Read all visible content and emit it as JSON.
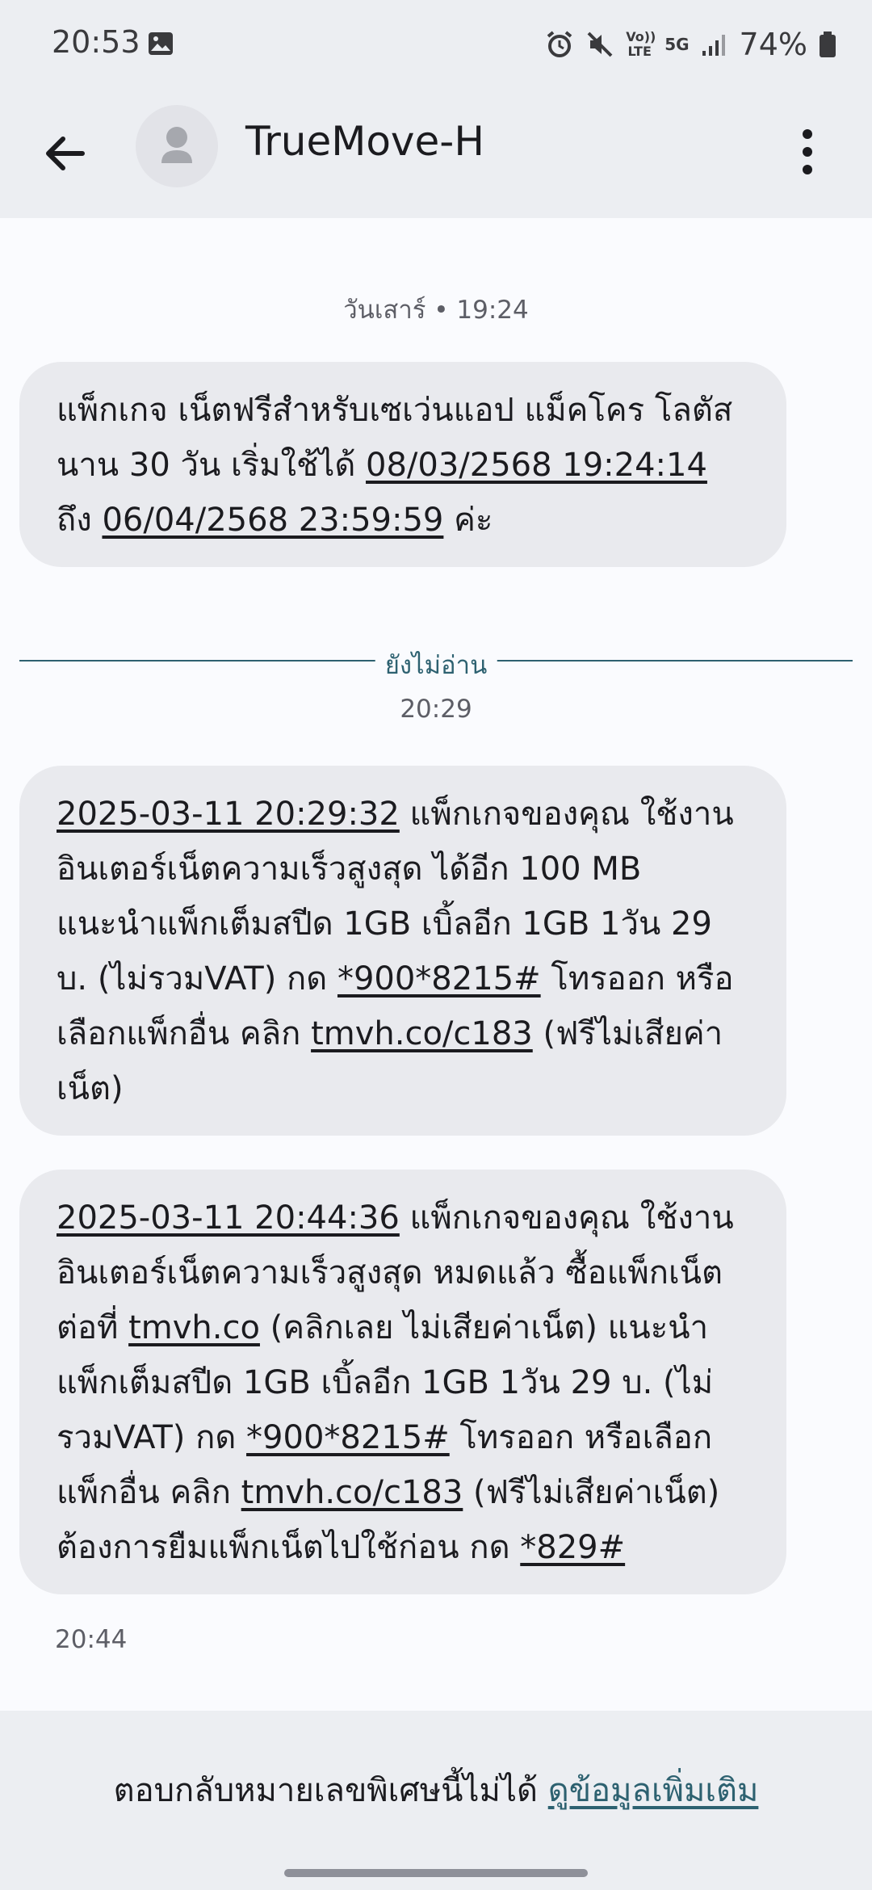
{
  "status_bar": {
    "time": "20:53",
    "battery": "74%",
    "network": "5G",
    "volte": "Vo)) LTE"
  },
  "header": {
    "contact": "TrueMove-H",
    "back_icon": "arrow-left-icon",
    "menu_icon": "more-vertical-icon"
  },
  "conversation": {
    "day_stamp": "วันเสาร์ • 19:24",
    "message1": {
      "t1": "แพ็กเกจ เน็ตฟรีสำหรับเซเว่นแอป แม็คโคร โลตัส นาน 30 วัน เริ่มใช้ได้ ",
      "l1": "08/03/2568 19:24:14",
      "t2": " ถึง ",
      "l2": "06/04/2568 23:59:59",
      "t3": " ค่ะ"
    },
    "unread_label": "ยังไม่อ่าน",
    "unread_time": "20:29",
    "message2": {
      "l1": "2025-03-11 20:29:32",
      "t1": " แพ็กเกจของคุณ ใช้งานอินเตอร์เน็ตความเร็วสูงสุด ได้อีก 100 MB แนะนำแพ็กเต็มสปีด 1GB เบิ้ลอีก 1GB 1วัน 29 บ. (ไม่รวมVAT) กด ",
      "l2": "*900*8215#",
      "t2": " โทรออก หรือเลือกแพ็กอื่น คลิก ",
      "l3": "tmvh.co/c183",
      "t3": " (ฟรีไม่เสียค่าเน็ต)"
    },
    "message3": {
      "l1": "2025-03-11 20:44:36",
      "t1": " แพ็กเกจของคุณ ใช้งานอินเตอร์เน็ตความเร็วสูงสุด หมดแล้ว ซื้อแพ็กเน็ตต่อที่ ",
      "l2": "tmvh.co",
      "t2": " (คลิกเลย ไม่เสียค่าเน็ต) แนะนำแพ็กเต็มสปีด 1GB เบิ้ลอีก 1GB 1วัน 29 บ. (ไม่รวมVAT) กด ",
      "l3": "*900*8215#",
      "t3": " โทรออก หรือเลือกแพ็กอื่น คลิก ",
      "l4": "tmvh.co/c183",
      "t4": " (ฟรีไม่เสียค่าเน็ต) ต้องการยืมแพ็กเน็ตไปใช้ก่อน กด ",
      "l5": "*829#"
    },
    "last_time": "20:44"
  },
  "footer": {
    "notice": "ตอบกลับหมายเลขพิเศษนี้ไม่ได้ ",
    "link": "ดูข้อมูลเพิ่มเติม"
  },
  "colors": {
    "accent": "#2d6170",
    "bubble": "#e9eaee",
    "chrome": "#eceef2"
  }
}
